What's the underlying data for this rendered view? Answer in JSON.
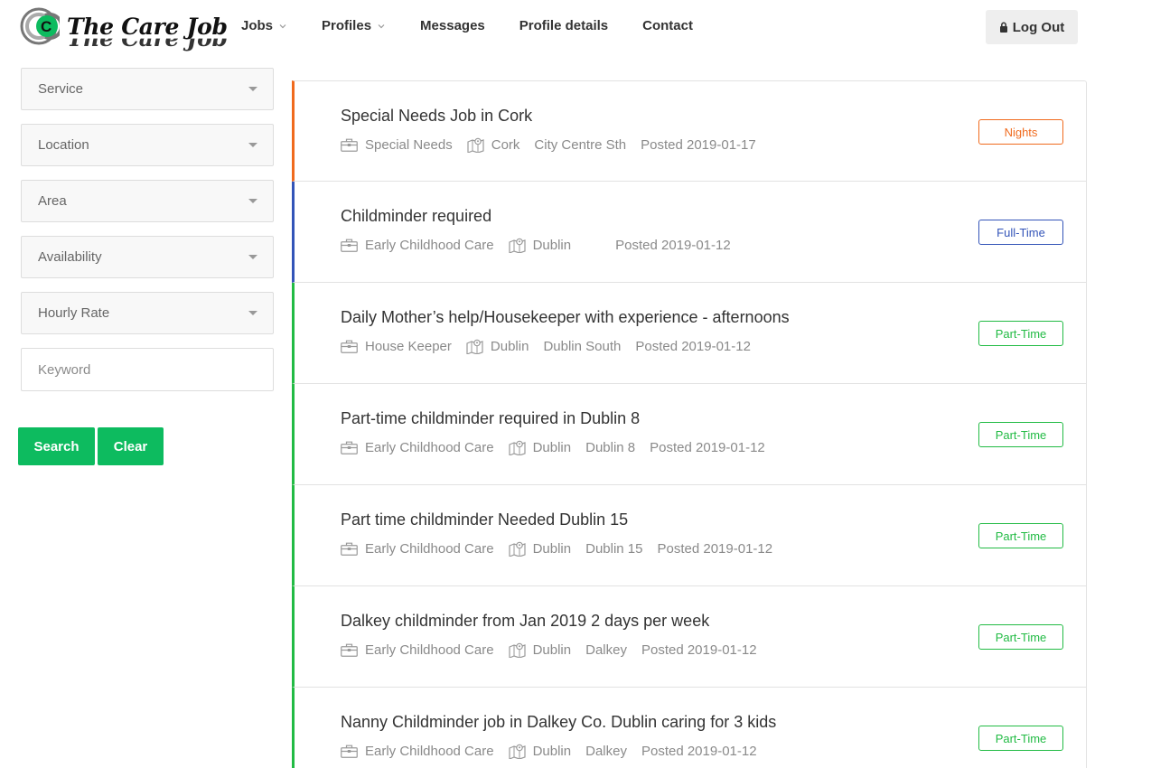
{
  "header": {
    "logo_text": "The Care Job",
    "nav": {
      "jobs": "Jobs",
      "profiles": "Profiles",
      "messages": "Messages",
      "profile_details": "Profile details",
      "contact": "Contact"
    },
    "logout": "Log Out"
  },
  "filters": {
    "service": "Service",
    "location": "Location",
    "area": "Area",
    "availability": "Availability",
    "hourly_rate": "Hourly Rate",
    "keyword_placeholder": "Keyword",
    "search_button": "Search",
    "clear_button": "Clear"
  },
  "colors": {
    "brand_green": "#0dbb5f",
    "part_time": "#22bb44",
    "nights": "#f06a1d",
    "full_time": "#3354b8"
  },
  "jobs": [
    {
      "title": "Special Needs Job in Cork",
      "service": "Special Needs",
      "location": "Cork",
      "area": "City Centre Sth",
      "posted": "Posted 2019-01-17",
      "type": "Nights",
      "accent": "#f06a1d"
    },
    {
      "title": "Childminder required",
      "service": "Early Childhood Care",
      "location": "Dublin",
      "area": "",
      "posted": "Posted 2019-01-12",
      "type": "Full-Time",
      "accent": "#3354b8"
    },
    {
      "title": "Daily Mother’s help/Housekeeper with experience - afternoons",
      "service": "House Keeper",
      "location": "Dublin",
      "area": "Dublin South",
      "posted": "Posted 2019-01-12",
      "type": "Part-Time",
      "accent": "#22bb44"
    },
    {
      "title": "Part-time childminder required in Dublin 8",
      "service": "Early Childhood Care",
      "location": "Dublin",
      "area": "Dublin 8",
      "posted": "Posted 2019-01-12",
      "type": "Part-Time",
      "accent": "#22bb44"
    },
    {
      "title": "Part time childminder Needed Dublin 15",
      "service": "Early Childhood Care",
      "location": "Dublin",
      "area": "Dublin 15",
      "posted": "Posted 2019-01-12",
      "type": "Part-Time",
      "accent": "#22bb44"
    },
    {
      "title": "Dalkey childminder from Jan 2019 2 days per week",
      "service": "Early Childhood Care",
      "location": "Dublin",
      "area": "Dalkey",
      "posted": "Posted 2019-01-12",
      "type": "Part-Time",
      "accent": "#22bb44"
    },
    {
      "title": "Nanny Childminder job in Dalkey Co. Dublin caring for 3 kids",
      "service": "Early Childhood Care",
      "location": "Dublin",
      "area": "Dalkey",
      "posted": "Posted 2019-01-12",
      "type": "Part-Time",
      "accent": "#22bb44"
    }
  ]
}
